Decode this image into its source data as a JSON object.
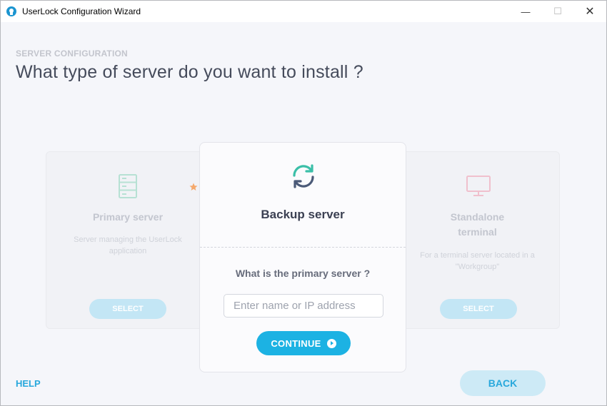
{
  "window": {
    "title": "UserLock Configuration Wizard",
    "controls": {
      "minimize": "—",
      "maximize": "☐",
      "close": "✕"
    }
  },
  "header": {
    "section_label": "SERVER CONFIGURATION",
    "heading": "What type of server do you want to install ?"
  },
  "cards": {
    "primary": {
      "title": "Primary server",
      "description": "Server managing the UserLock application",
      "select_label": "SELECT",
      "icon": "server-icon",
      "recommended_icon": "star-icon"
    },
    "standalone": {
      "title_line1": "Standalone",
      "title_line2": "terminal",
      "description": "For a terminal server located in a \"Workgroup\"",
      "select_label": "SELECT",
      "icon": "monitor-icon"
    }
  },
  "modal": {
    "icon": "sync-icon",
    "title": "Backup server",
    "question": "What is the primary server ?",
    "input_placeholder": "Enter name or IP address",
    "input_value": "",
    "continue_label": "CONTINUE"
  },
  "footer": {
    "help_label": "HELP",
    "back_label": "BACK"
  },
  "colors": {
    "accent": "#1cb2e3",
    "heading": "#454b5b",
    "background": "#f5f6fa",
    "star": "#f5a96c",
    "sync_teal": "#3bbfa8",
    "sync_slate": "#4b5a78"
  }
}
